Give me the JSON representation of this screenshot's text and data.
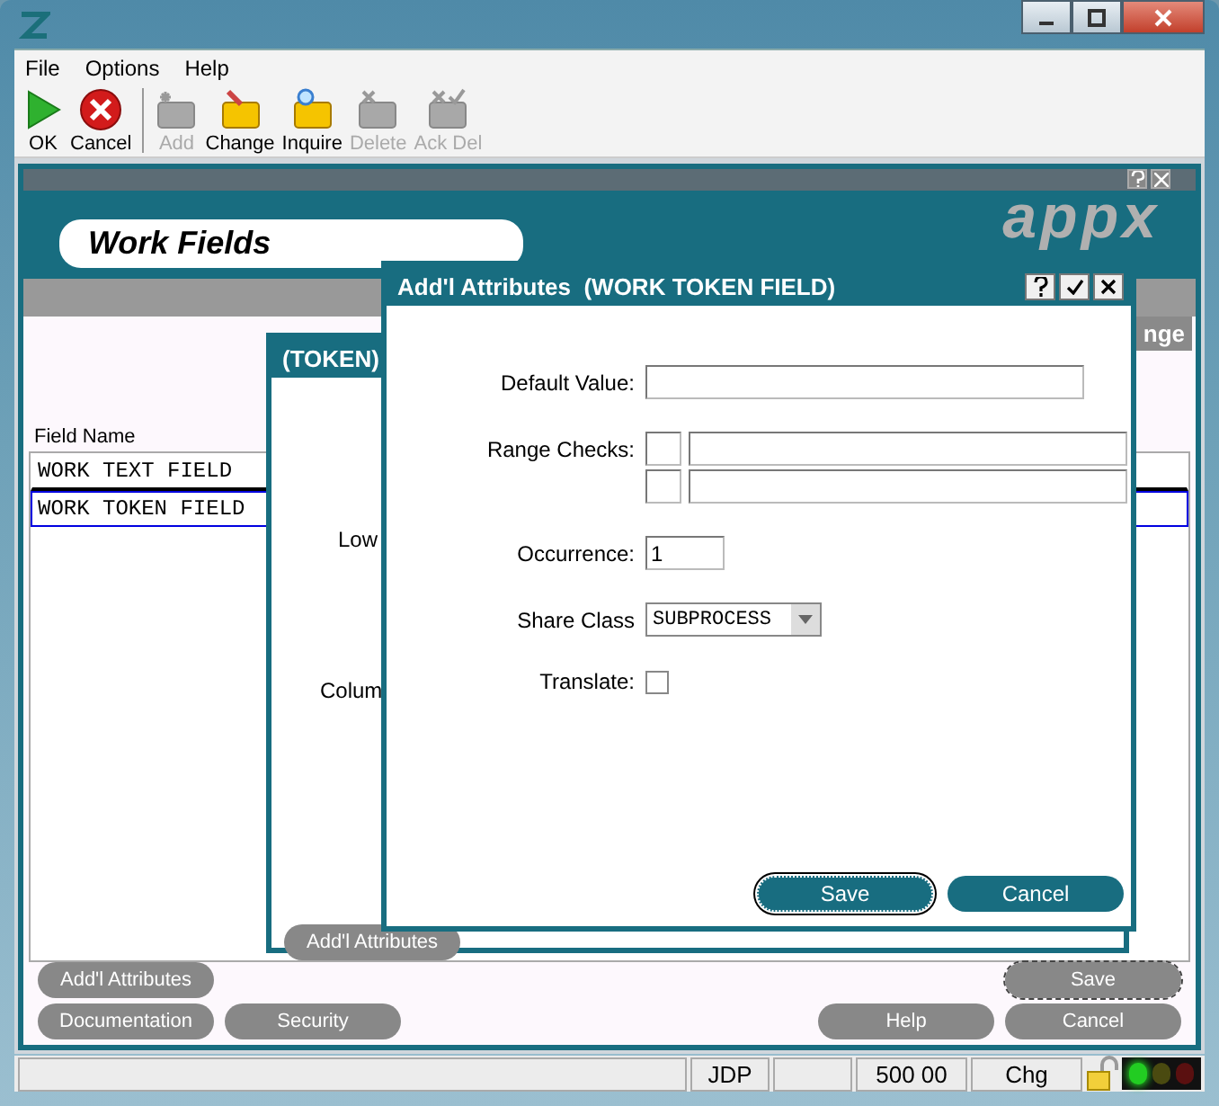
{
  "menu": [
    "File",
    "Options",
    "Help"
  ],
  "toolbar": [
    {
      "kind": "ok",
      "label": "OK",
      "disabled": false
    },
    {
      "kind": "cancel",
      "label": "Cancel",
      "disabled": false
    },
    {
      "kind": "add",
      "label": "Add",
      "disabled": true
    },
    {
      "kind": "change",
      "label": "Change",
      "disabled": false
    },
    {
      "kind": "inquire",
      "label": "Inquire",
      "disabled": false
    },
    {
      "kind": "delete",
      "label": "Delete",
      "disabled": true
    },
    {
      "kind": "ackdel",
      "label": "Ack Del",
      "disabled": true
    }
  ],
  "form": {
    "title": "Work Fields",
    "logo": "appx",
    "tab": "nge",
    "column": "Field Name",
    "rows": [
      {
        "text": "WORK TEXT FIELD",
        "selected": false
      },
      {
        "text": "WORK TOKEN FIELD",
        "selected": true
      }
    ],
    "buttons_left": [
      "Add'l Attributes",
      "Documentation",
      "Security"
    ],
    "save": "Save",
    "buttons_right": [
      "Help",
      "Cancel"
    ]
  },
  "token_dialog": {
    "title": "(TOKEN)",
    "labels": [
      "Low",
      "Colum"
    ],
    "button": "Add'l Attributes"
  },
  "attr_dialog": {
    "title": "Add'l Attributes  (WORK TOKEN FIELD)",
    "default_value": {
      "label": "Default Value:"
    },
    "range_checks": {
      "label": "Range Checks:"
    },
    "occurrence": {
      "label": "Occurrence:",
      "value": "1"
    },
    "share_class": {
      "label": "Share Class",
      "value": "SUBPROCESS"
    },
    "translate": {
      "label": "Translate:",
      "checked": false
    },
    "buttons": [
      {
        "label": "Save",
        "focused": true
      },
      {
        "label": "Cancel",
        "focused": false
      }
    ]
  },
  "status_bar": {
    "segments": [
      "JDP",
      "500 00",
      "Chg"
    ],
    "lights": [
      {
        "color": "#22cc22",
        "on": true
      },
      {
        "color": "#4a4a10",
        "on": false
      },
      {
        "color": "#5a1010",
        "on": false
      }
    ]
  }
}
